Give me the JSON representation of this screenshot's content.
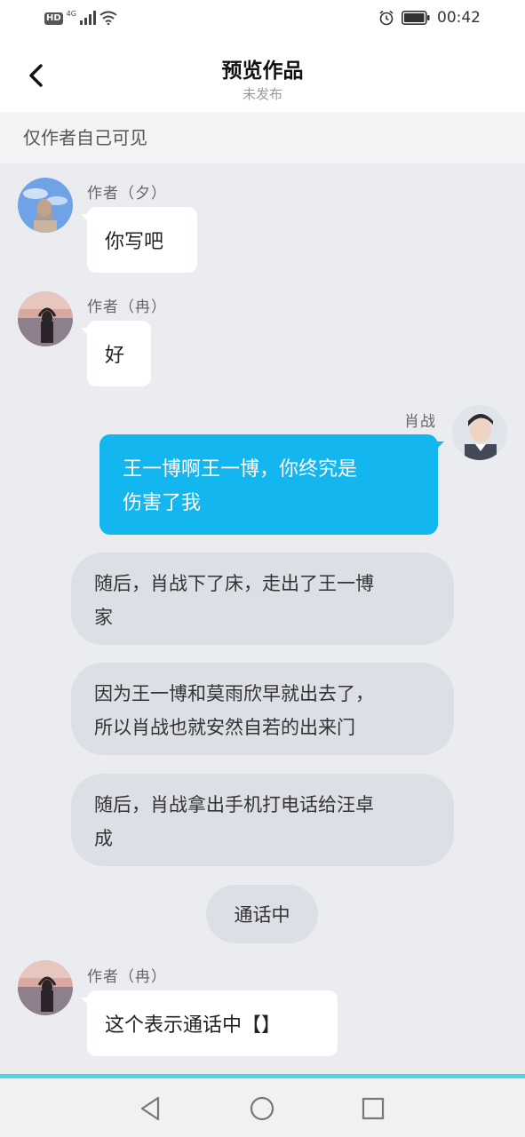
{
  "status_bar": {
    "hd": "HD",
    "network": "4G",
    "time": "00:42"
  },
  "header": {
    "title": "预览作品",
    "subtitle": "未发布"
  },
  "notice": "仅作者自己可见",
  "messages": [
    {
      "name": "作者（夕）",
      "text": "你写吧"
    },
    {
      "name": "作者（冉）",
      "text": "好"
    },
    {
      "name": "肖战",
      "text_lines": [
        "王一博啊王一博，你终究是",
        "伤害了我"
      ]
    },
    {
      "name": "作者（冉）",
      "text": "这个表示通话中【】"
    }
  ],
  "narrations": [
    {
      "lines": [
        "随后，肖战下了床，走出了王一博",
        "家"
      ]
    },
    {
      "lines": [
        "因为王一博和莫雨欣早就出去了，",
        "所以肖战也就安然自若的出来门"
      ]
    },
    {
      "lines": [
        "随后，肖战拿出手机打电话给汪卓",
        "成"
      ]
    }
  ],
  "call_status": "通话中",
  "colors": {
    "accent_blue": "#13b6ee",
    "nav_accent": "#4fd3e6"
  },
  "icons": {
    "back": "chevron-left-icon",
    "alarm": "alarm-icon",
    "battery": "battery-icon",
    "nav_back": "triangle-back-icon",
    "nav_home": "circle-home-icon",
    "nav_recent": "square-recent-icon"
  }
}
